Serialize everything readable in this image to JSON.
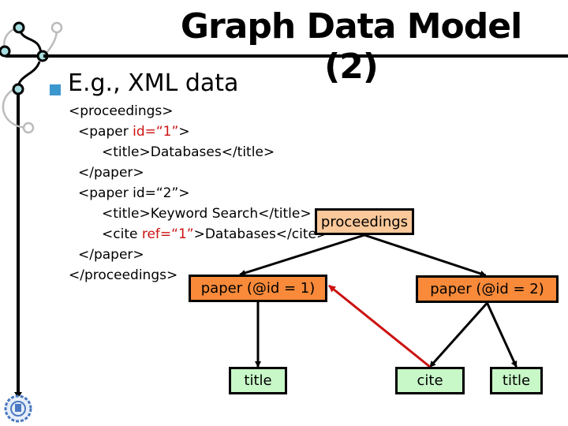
{
  "slide": {
    "title": "Graph Data Model (2)",
    "bullet": "E.g., XML data",
    "accent_color": "#3d97cf"
  },
  "xml_lines": [
    {
      "indent": 0,
      "parts": [
        {
          "t": "<proceedings>",
          "red": false
        }
      ]
    },
    {
      "indent": 1,
      "parts": [
        {
          "t": "<paper ",
          "red": false
        },
        {
          "t": "id=“1”",
          "red": true
        },
        {
          "t": ">",
          "red": false
        }
      ]
    },
    {
      "indent": 2,
      "parts": [
        {
          "t": "<title>Databases</title>",
          "red": false
        }
      ]
    },
    {
      "indent": 1,
      "parts": [
        {
          "t": "</paper>",
          "red": false
        }
      ]
    },
    {
      "indent": 1,
      "parts": [
        {
          "t": "<paper id=“2”>",
          "red": false
        }
      ]
    },
    {
      "indent": 2,
      "parts": [
        {
          "t": "<title>Keyword Search</title>",
          "red": false
        }
      ]
    },
    {
      "indent": 2,
      "parts": [
        {
          "t": "<cite ",
          "red": false
        },
        {
          "t": "ref=“1”",
          "red": true
        },
        {
          "t": ">Databases</cite>",
          "red": false
        }
      ]
    },
    {
      "indent": 1,
      "parts": [
        {
          "t": "</paper>",
          "red": false
        }
      ]
    },
    {
      "indent": 0,
      "parts": [
        {
          "t": "</proceedings>",
          "red": false
        }
      ]
    }
  ],
  "graph": {
    "nodes": {
      "proceedings": "proceedings",
      "paper1": "paper (@id = 1)",
      "paper2": "paper (@id = 2)",
      "title1": "title",
      "cite": "cite",
      "title2": "title"
    },
    "edges": [
      {
        "from": "proceedings",
        "to": "paper1",
        "kind": "child"
      },
      {
        "from": "proceedings",
        "to": "paper2",
        "kind": "child"
      },
      {
        "from": "paper1",
        "to": "title1",
        "kind": "child"
      },
      {
        "from": "paper2",
        "to": "cite",
        "kind": "child"
      },
      {
        "from": "paper2",
        "to": "title2",
        "kind": "child"
      },
      {
        "from": "cite",
        "to": "paper1",
        "kind": "reference"
      }
    ],
    "colors": {
      "root_fill": "#fbc89a",
      "paper_fill": "#f88a3a",
      "leaf_fill": "#c8f7c8",
      "reference_edge": "#cc1111",
      "child_edge": "#000000"
    }
  }
}
